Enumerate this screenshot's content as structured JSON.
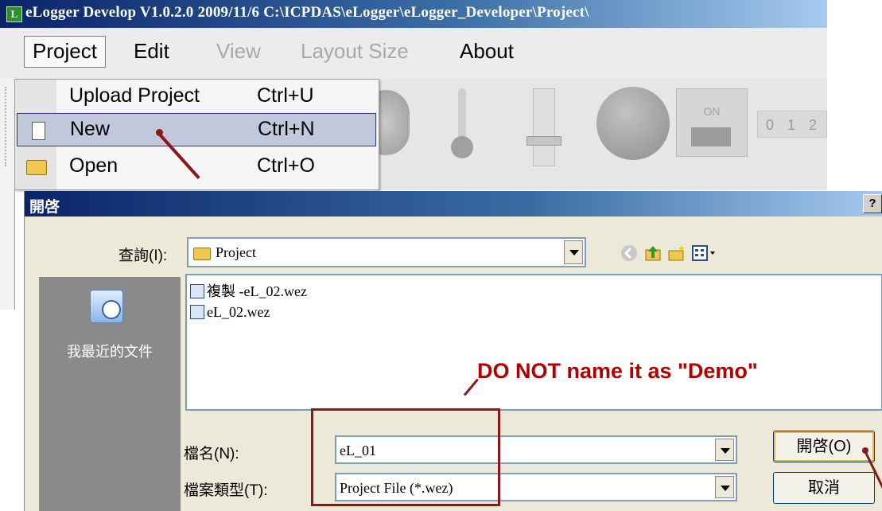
{
  "app": {
    "logo": "L",
    "title": "eLogger Develop V1.0.2.0  2009/11/6  C:\\ICPDAS\\eLogger\\eLogger_Developer\\Project\\"
  },
  "menubar": {
    "items": [
      {
        "label": "Project",
        "state": "active"
      },
      {
        "label": "Edit",
        "state": "enabled"
      },
      {
        "label": "View",
        "state": "disabled"
      },
      {
        "label": "Layout Size",
        "state": "disabled"
      },
      {
        "label": "About",
        "state": "enabled"
      }
    ]
  },
  "canvas": {
    "switch_label": "ON",
    "digits": "0 1 2"
  },
  "project_menu": {
    "items": [
      {
        "label": "Upload Project",
        "shortcut": "Ctrl+U",
        "icon": "none"
      },
      {
        "label": "New",
        "shortcut": "Ctrl+N",
        "icon": "new-document-icon",
        "highlighted": true
      },
      {
        "label": "Open",
        "shortcut": "Ctrl+O",
        "icon": "open-folder-icon"
      }
    ]
  },
  "dialog": {
    "title": "開啓",
    "help_button": "?",
    "look_in_label": "查詢(I):",
    "look_in_value": "Project",
    "toolbar_icons": [
      "back-icon",
      "up-folder-icon",
      "new-folder-icon",
      "view-menu-icon"
    ],
    "places": [
      {
        "label": "我最近的文件",
        "icon": "recent-documents-icon"
      }
    ],
    "files": [
      {
        "name": "複製 -eL_02.wez"
      },
      {
        "name": "eL_02.wez"
      }
    ],
    "filename_label": "檔名(N):",
    "filename_value": "eL_01",
    "filetype_label": "檔案類型(T):",
    "filetype_value": "Project File (*.wez)",
    "open_button": "開啓(O)",
    "cancel_button": "取消"
  },
  "annotation": {
    "note": "DO NOT name it as \"Demo\"",
    "color": "#b00000"
  },
  "colors": {
    "titlebar_start": "#0a246a",
    "titlebar_end": "#a6caf0",
    "menu_highlight": "#c2c8dc",
    "annotation": "#8a1a1a"
  }
}
